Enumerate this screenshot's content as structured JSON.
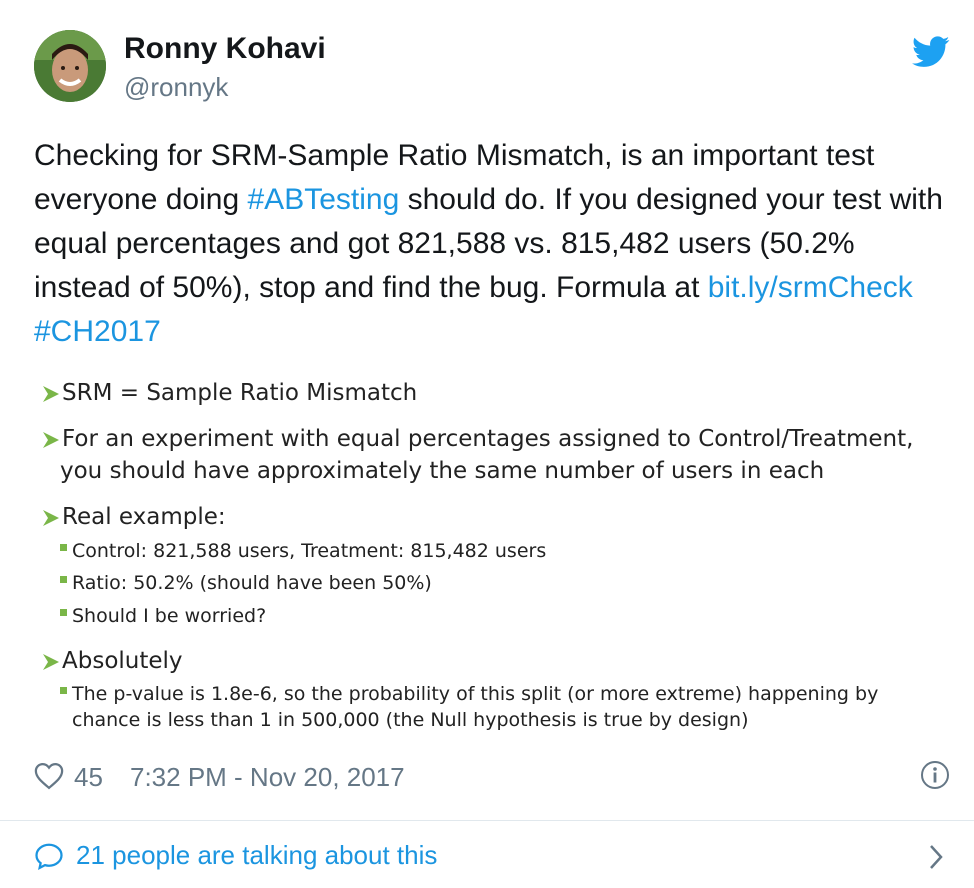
{
  "user": {
    "name": "Ronny Kohavi",
    "handle": "@ronnyk"
  },
  "tweet": {
    "text_1": "Checking for SRM-Sample Ratio Mismatch, is an important test everyone doing ",
    "hashtag_abtesting": "#ABTesting",
    "text_2": " should do. If you designed your test with equal percentages and got 821,588 vs. 815,482 users (50.2% instead of 50%), stop and find the bug.  Formula at ",
    "link": "bit.ly/srmCheck",
    "text_3": " ",
    "hashtag_ch2017": "#CH2017"
  },
  "slide": {
    "b1": "SRM = Sample Ratio Mismatch",
    "b2_line1": "For an experiment with equal percentages assigned to Control/Treatment,",
    "b2_line2": "you should have approximately the same number of users in each",
    "b3": "Real example:",
    "b3_s1": "Control: 821,588 users, Treatment: 815,482 users",
    "b3_s2": "Ratio: 50.2% (should have been 50%)",
    "b3_s3": "Should I be worried?",
    "b4": "Absolutely",
    "b4_s1_line1": "The p-value is 1.8e-6, so the probability of this split (or more extreme) happening by",
    "b4_s1_line2": "chance is less than 1 in 500,000 (the Null hypothesis is true by design)"
  },
  "meta": {
    "likes": "45",
    "timestamp": "7:32 PM - Nov 20, 2017"
  },
  "footer": {
    "talking": "21 people are talking about this"
  },
  "colors": {
    "link": "#1b95e0",
    "secondary_text": "#657786",
    "bullet_arrow": "#7ab648",
    "twitter_bird": "#1da1f2"
  },
  "icons": [
    "avatar-photo",
    "twitter-bird-icon",
    "heart-icon",
    "info-icon",
    "speech-bubble-icon",
    "chevron-right-icon",
    "arrow-bullet-icon",
    "square-bullet-icon"
  ]
}
